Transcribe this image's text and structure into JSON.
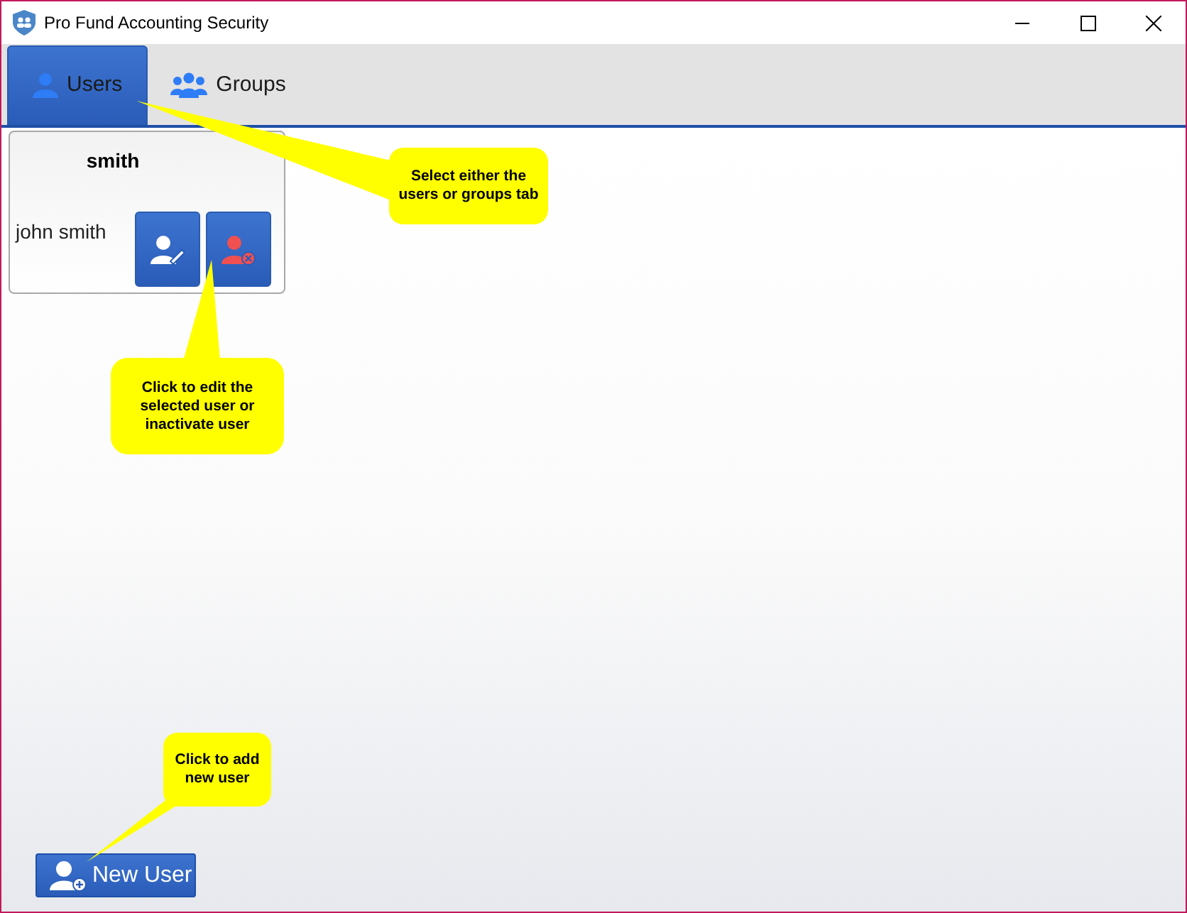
{
  "window": {
    "title": "Pro Fund Accounting Security"
  },
  "tabs": [
    {
      "label": "Users",
      "kind": "user",
      "selected": true
    },
    {
      "label": "Groups",
      "kind": "group",
      "selected": false
    }
  ],
  "user_card": {
    "username": "smith",
    "full_name": "john smith"
  },
  "new_user_button": {
    "label": "New User"
  },
  "callouts": [
    {
      "text": "Select either the users or groups tab"
    },
    {
      "text": "Click to edit the selected user or inactivate user"
    },
    {
      "text": "Click to add new user"
    }
  ]
}
